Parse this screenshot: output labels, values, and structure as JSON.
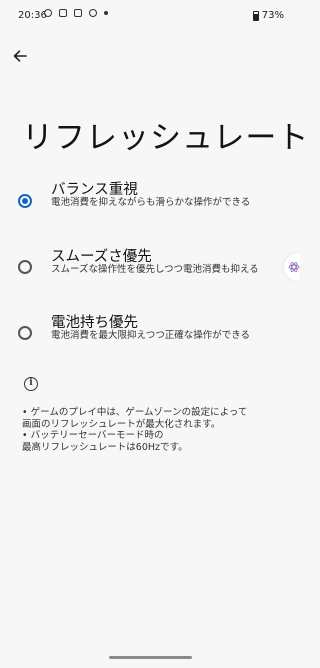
{
  "status_bar": {
    "time": "20:36",
    "battery": "73%"
  },
  "page": {
    "title": "リフレッシュレート"
  },
  "options": [
    {
      "title": "バランス重視",
      "desc": "電池消費を抑えながらも滑らかな操作ができる",
      "selected": true
    },
    {
      "title": "スムーズさ優先",
      "desc": "スムーズな操作性を優先しつつ電池消費も抑える",
      "selected": false
    },
    {
      "title": "電池持ち優先",
      "desc": "電池消費を最大限抑えつつ正確な操作ができる",
      "selected": false
    }
  ],
  "notes": [
    "• ゲームのプレイ中は、ゲームゾーンの設定によって",
    "画面のリフレッシュレートが最大化されます。",
    "• バッテリーセーバーモード時の",
    "最高リフレッシュレートは60Hzです。"
  ],
  "colors": {
    "accent": "#1565c0",
    "background": "#f7f7f8"
  },
  "icons": {
    "back": "arrow-left",
    "info": "info-circle"
  }
}
